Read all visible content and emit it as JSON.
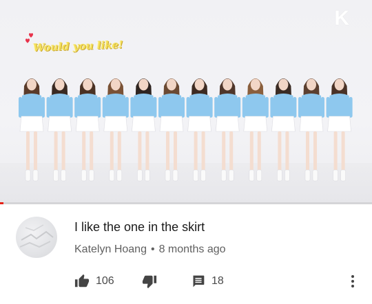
{
  "video": {
    "brand_logo": "K",
    "caption": "Would you like!",
    "progress": 0.01,
    "colors": {
      "progress": "#e62117",
      "caption": "#f3df5a",
      "top": "#8ec8ee",
      "skirt": "#ffffff"
    }
  },
  "comment": {
    "text": "I like the one in the skirt",
    "author": "Katelyn Hoang",
    "separator": "•",
    "time": "8 months ago",
    "likes": "106",
    "replies": "18"
  },
  "icons": {
    "like": "thumbs-up-icon",
    "dislike": "thumbs-down-icon",
    "reply": "reply-icon",
    "more": "more-vertical-icon"
  }
}
